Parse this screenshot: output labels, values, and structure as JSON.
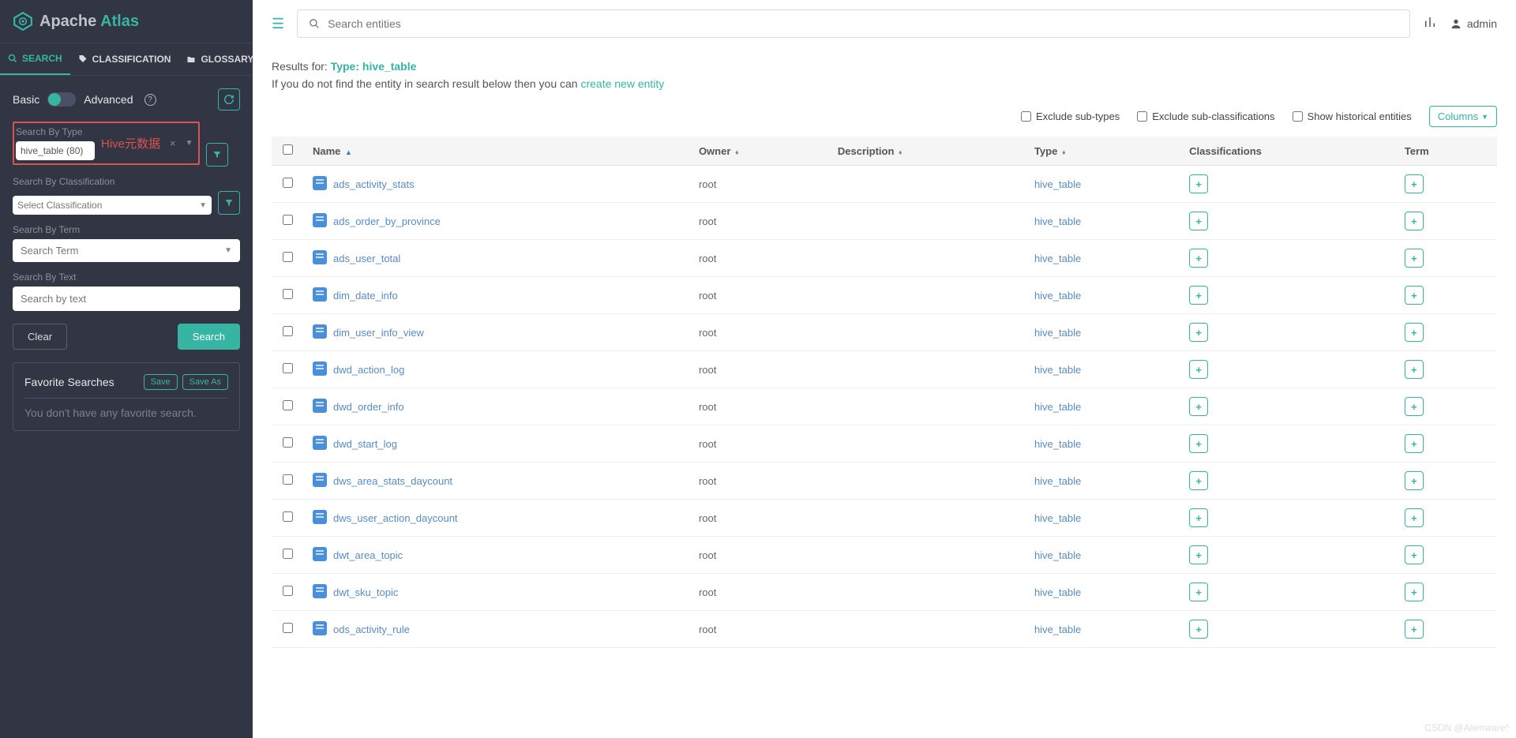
{
  "app": {
    "brand1": "Apache",
    "brand2": "Atlas"
  },
  "tabs": {
    "search": "SEARCH",
    "classification": "CLASSIFICATION",
    "glossary": "GLOSSARY"
  },
  "mode": {
    "basic": "Basic",
    "advanced": "Advanced"
  },
  "sidebar": {
    "type_label": "Search By Type",
    "type_value": "hive_table (80)",
    "annotation": "Hive元数据",
    "classification_label": "Search By Classification",
    "classification_placeholder": "Select Classification",
    "term_label": "Search By Term",
    "term_placeholder": "Search Term",
    "text_label": "Search By Text",
    "text_placeholder": "Search by text",
    "clear_btn": "Clear",
    "search_btn": "Search"
  },
  "fav": {
    "title": "Favorite Searches",
    "save": "Save",
    "save_as": "Save As",
    "empty": "You don't have any favorite search."
  },
  "topbar": {
    "search_placeholder": "Search entities",
    "user": "admin"
  },
  "results": {
    "prefix": "Results for:",
    "type_label": "Type: ",
    "type_value": "hive_table",
    "hint_prefix": "If you do not find the entity in search result below then you can ",
    "hint_link": "create new entity"
  },
  "filters": {
    "exclude_sub_types": "Exclude sub-types",
    "exclude_sub_class": "Exclude sub-classifications",
    "show_historical": "Show historical entities",
    "columns_btn": "Columns"
  },
  "columns": {
    "name": "Name",
    "owner": "Owner",
    "description": "Description",
    "type": "Type",
    "classifications": "Classifications",
    "term": "Term"
  },
  "rows": [
    {
      "name": "ads_activity_stats",
      "owner": "root",
      "type": "hive_table"
    },
    {
      "name": "ads_order_by_province",
      "owner": "root",
      "type": "hive_table"
    },
    {
      "name": "ads_user_total",
      "owner": "root",
      "type": "hive_table"
    },
    {
      "name": "dim_date_info",
      "owner": "root",
      "type": "hive_table"
    },
    {
      "name": "dim_user_info_view",
      "owner": "root",
      "type": "hive_table"
    },
    {
      "name": "dwd_action_log",
      "owner": "root",
      "type": "hive_table"
    },
    {
      "name": "dwd_order_info",
      "owner": "root",
      "type": "hive_table"
    },
    {
      "name": "dwd_start_log",
      "owner": "root",
      "type": "hive_table"
    },
    {
      "name": "dws_area_stats_daycount",
      "owner": "root",
      "type": "hive_table"
    },
    {
      "name": "dws_user_action_daycount",
      "owner": "root",
      "type": "hive_table"
    },
    {
      "name": "dwt_area_topic",
      "owner": "root",
      "type": "hive_table"
    },
    {
      "name": "dwt_sku_topic",
      "owner": "root",
      "type": "hive_table"
    },
    {
      "name": "ods_activity_rule",
      "owner": "root",
      "type": "hive_table"
    }
  ],
  "watermark": "CSDN @Alienware^"
}
